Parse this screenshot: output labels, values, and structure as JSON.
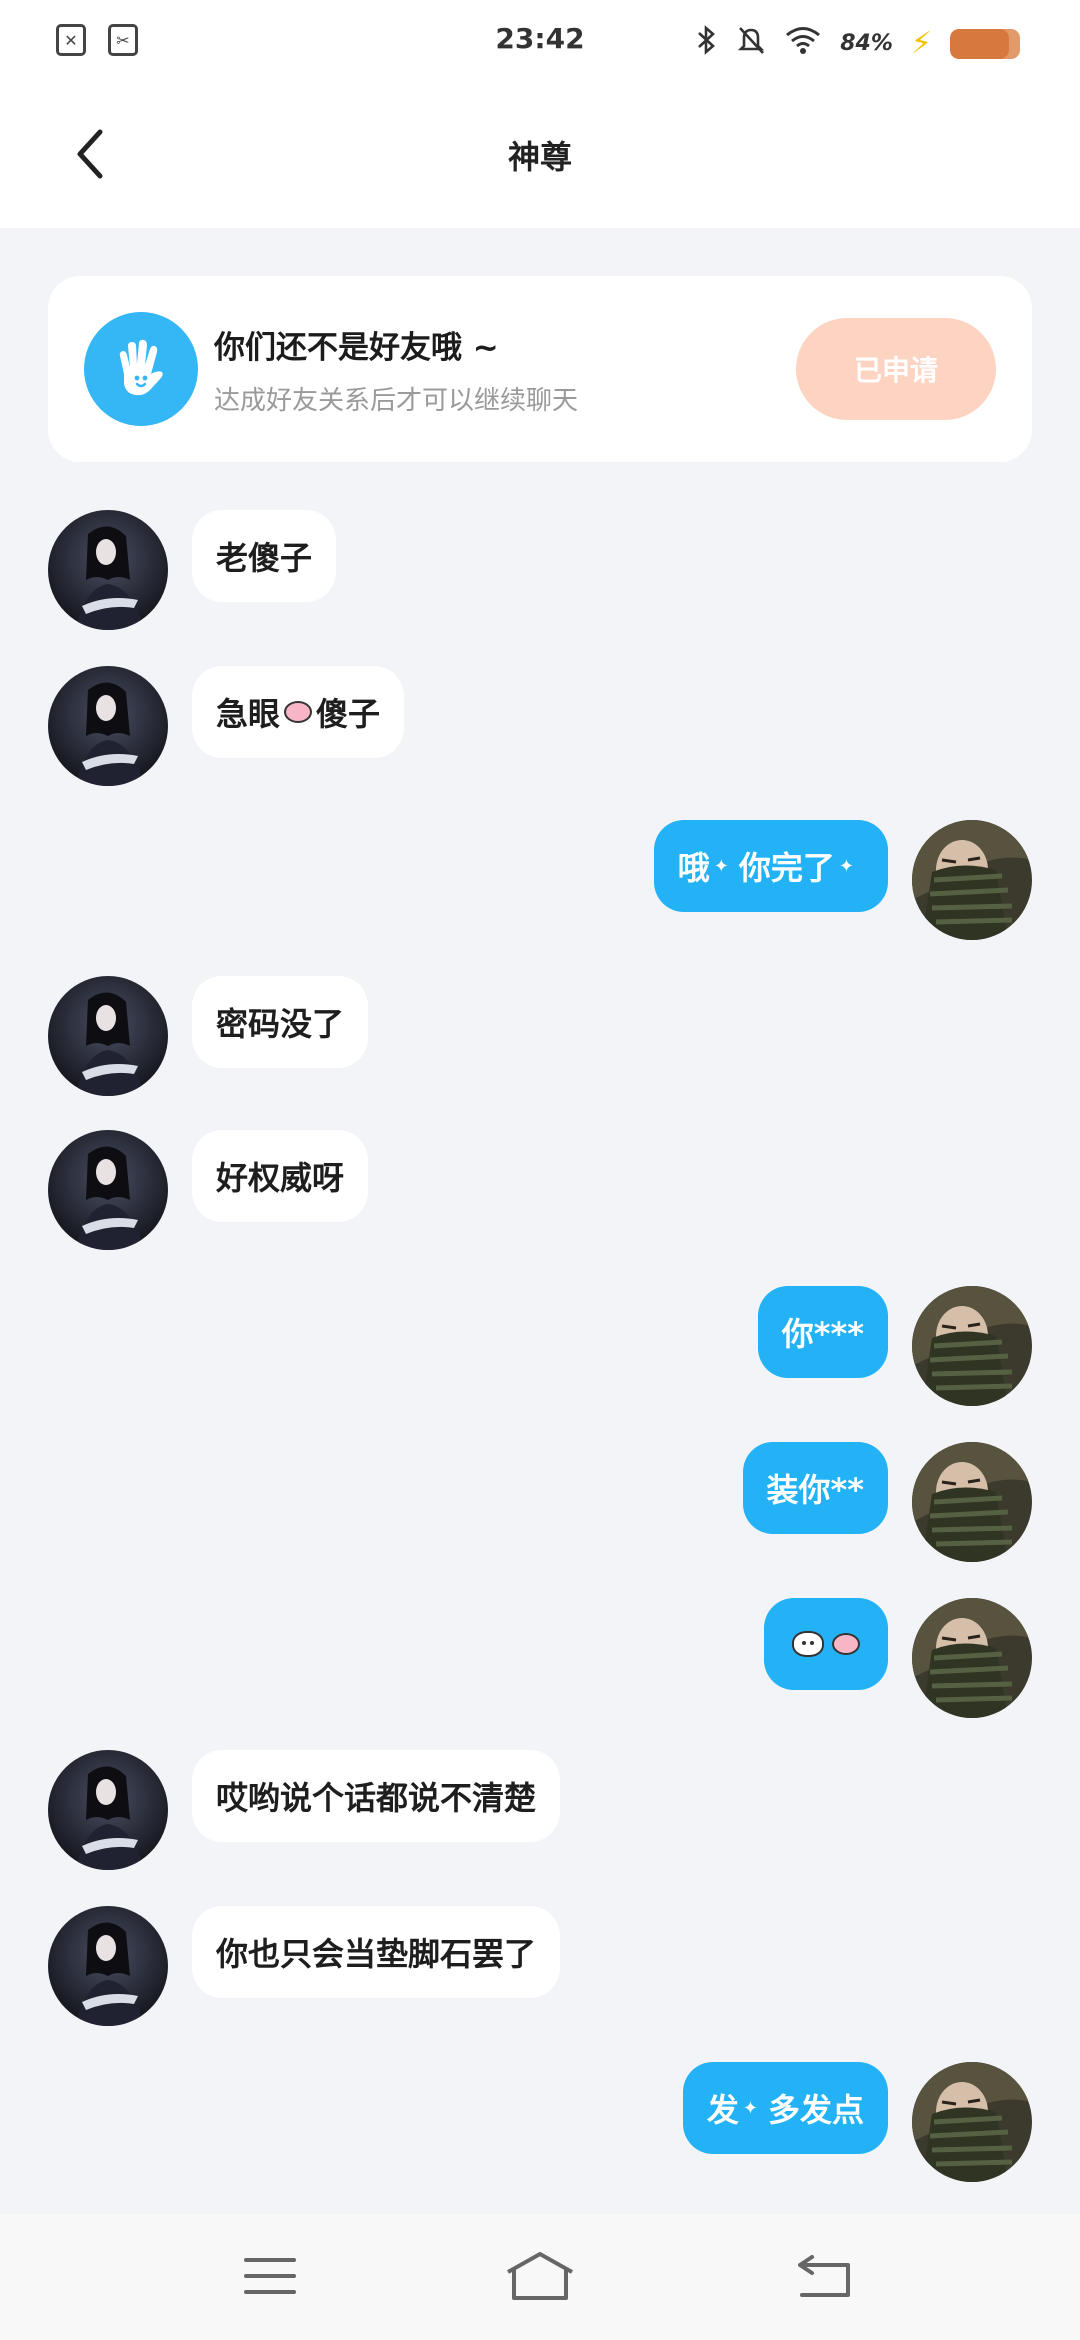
{
  "status_bar": {
    "time": "23:42",
    "battery_percent": "84%",
    "battery_level": 0.84,
    "icons": [
      "sim-icon",
      "app-icon",
      "bluetooth-icon",
      "mute-icon",
      "wifi-icon",
      "charging-icon",
      "battery-icon"
    ]
  },
  "header": {
    "title": "神尊",
    "back_icon": "chevron-left-icon"
  },
  "friend_card": {
    "title": "你们还不是好友哦 ~",
    "subtitle": "达成好友关系后才可以继续聊天",
    "button_label": "已申请",
    "icon": "wave-hand-icon",
    "accent_color": "#35b6f5",
    "button_color": "#fdd3c2"
  },
  "messages": [
    {
      "side": "left",
      "text": "老傻子"
    },
    {
      "side": "left",
      "text_a": "急眼",
      "text_b": "傻子"
    },
    {
      "side": "right",
      "text_a": "哦",
      "text_b": "你完了"
    },
    {
      "side": "left",
      "text": "密码没了"
    },
    {
      "side": "left",
      "text": "好权威呀"
    },
    {
      "side": "right",
      "text": "你***"
    },
    {
      "side": "right",
      "text": "装你**"
    },
    {
      "side": "right",
      "emoji_only": true
    },
    {
      "side": "left",
      "text": "哎哟说个话都说不清楚"
    },
    {
      "side": "left",
      "text": "你也只会当垫脚石罢了"
    },
    {
      "side": "right",
      "text_a": "发",
      "text_b": "多发点"
    }
  ],
  "colors": {
    "outgoing_bubble": "#23b2f5",
    "incoming_bubble": "#ffffff",
    "background": "#f2f4f8"
  },
  "nav_bar": {
    "icons": [
      "menu-icon",
      "home-icon",
      "back-icon"
    ]
  }
}
